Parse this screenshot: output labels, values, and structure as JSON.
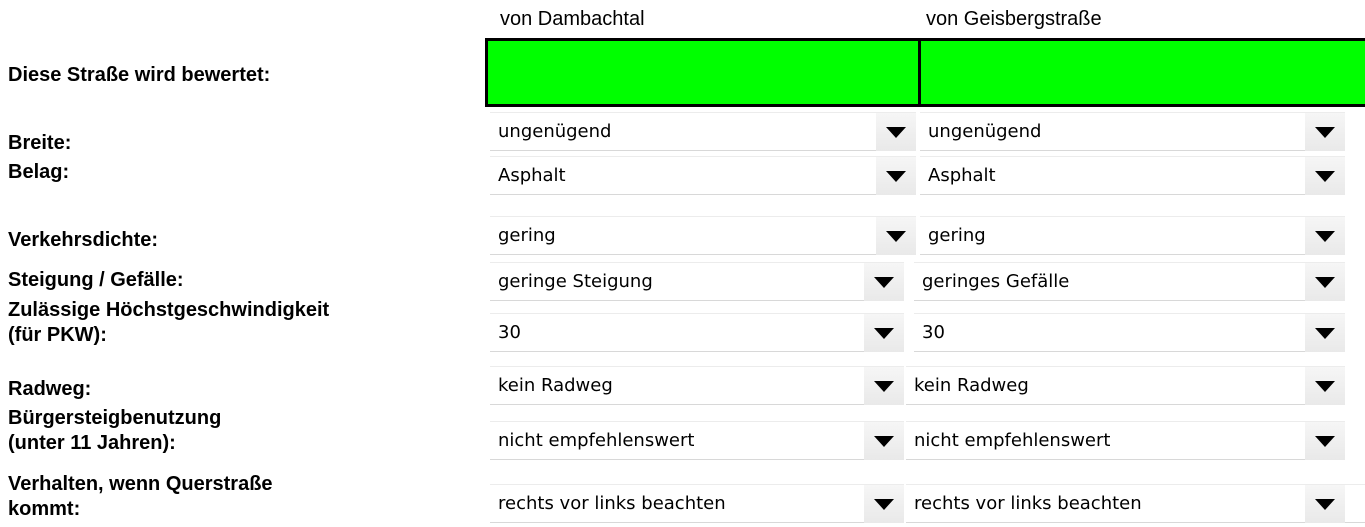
{
  "columns": {
    "left_header": "von Dambachtal",
    "right_header": "von Geisbergstraße"
  },
  "labels": {
    "rated": "Diese Straße wird bewertet:",
    "breite": "Breite:",
    "belag": "Belag:",
    "verkehr": "Verkehrsdichte:",
    "steigung": "Steigung / Gefälle:",
    "tempo_l1": "Zulässige Höchstgeschwindigkeit",
    "tempo_l2": "(für PKW):",
    "radweg": "Radweg:",
    "buerger_l1": "Bürgersteigbenutzung",
    "buerger_l2": "(unter 11 Jahren):",
    "quer_l1": "Verhalten, wenn Querstraße",
    "quer_l2": "kommt:"
  },
  "rating_color": "#00ff00",
  "left": {
    "breite": "ungenügend",
    "belag": "Asphalt",
    "verkehr": "gering",
    "steigung": "geringe Steigung",
    "tempo": "30",
    "radweg": "kein Radweg",
    "buerger": "nicht empfehlenswert",
    "quer": "rechts vor links beachten"
  },
  "right": {
    "breite": "ungenügend",
    "belag": "Asphalt",
    "verkehr": "gering",
    "steigung": "geringes Gefälle",
    "tempo": "30",
    "radweg": "kein Radweg",
    "buerger": "nicht empfehlenswert",
    "quer": "rechts vor links beachten"
  }
}
